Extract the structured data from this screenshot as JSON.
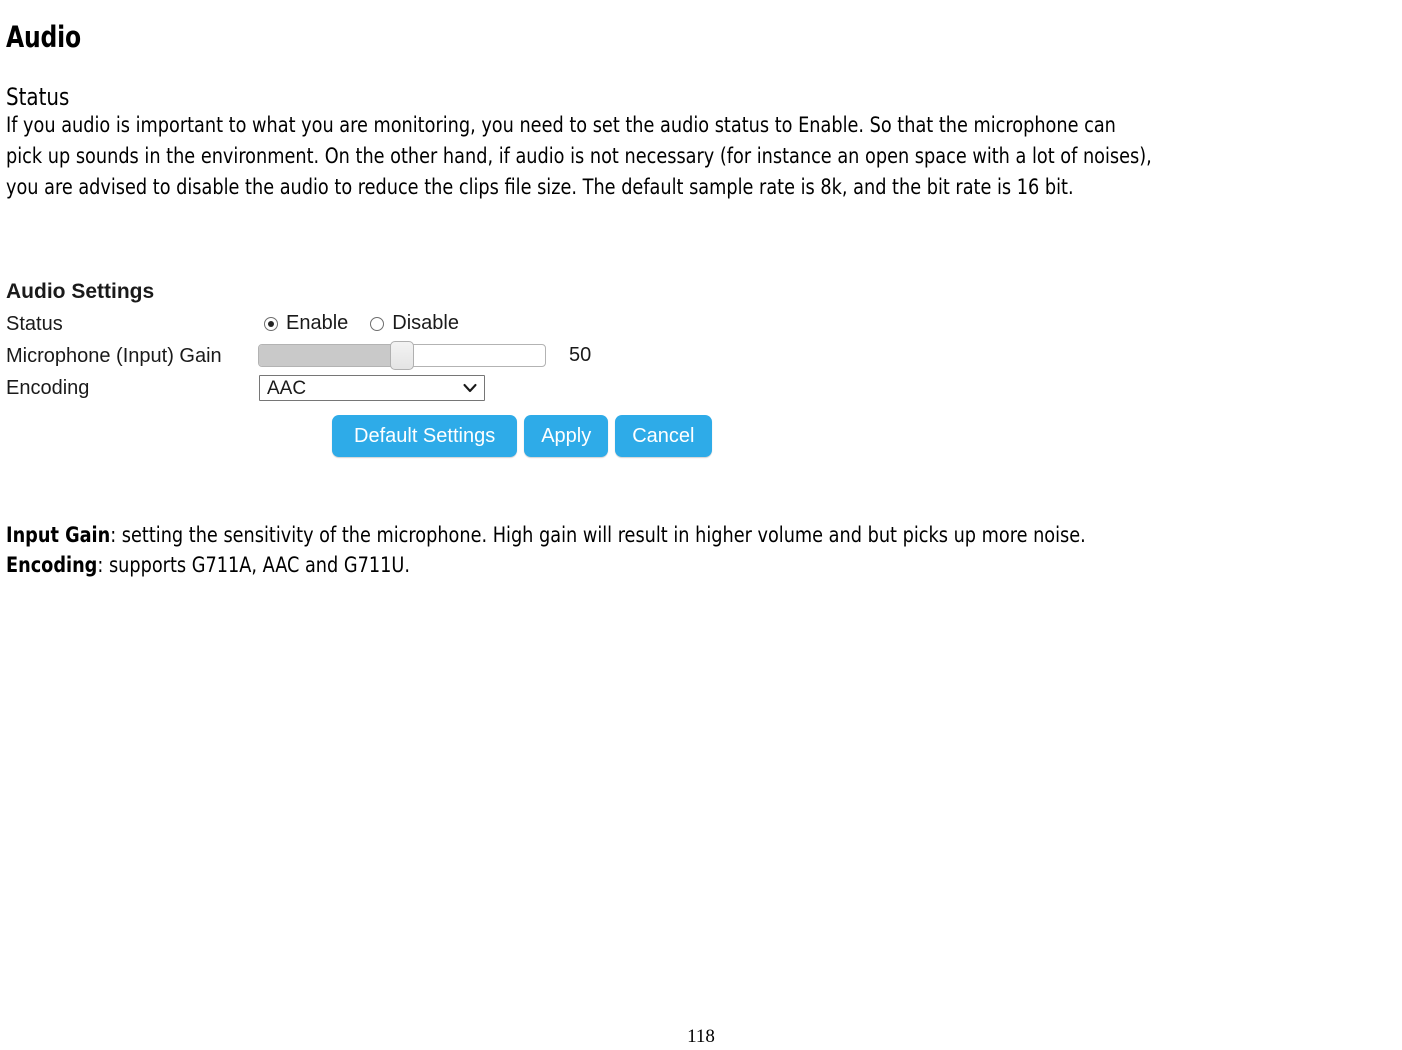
{
  "document": {
    "heading": "Audio",
    "subheading": "Status",
    "paragraph_lines": [
      "If you audio is important to what you are monitoring, you need to set the audio status to Enable. So that the microphone can",
      "pick up sounds in the environment. On the other hand, if audio is not necessary (for instance an open space with a lot of noises),",
      "you are advised to disable the audio to reduce the clips file size. The default sample rate is 8k, and the bit rate is 16 bit."
    ],
    "notes": [
      {
        "term": "Input Gain",
        "text": ": setting the sensitivity of the microphone. High gain will result in higher volume and but picks up more noise."
      },
      {
        "term": "Encoding",
        "text": ": supports G711A, AAC and G711U."
      }
    ],
    "page_number": "118"
  },
  "audio_settings": {
    "panel_title": "Audio Settings",
    "labels": {
      "status": "Status",
      "microphone_gain": "Microphone (Input) Gain",
      "encoding": "Encoding"
    },
    "status": {
      "selected": "Enable",
      "options": [
        {
          "label": "Enable",
          "checked": true
        },
        {
          "label": "Disable",
          "checked": false
        }
      ]
    },
    "gain": {
      "value": "50",
      "percent": 50
    },
    "encoding": {
      "selected": "AAC",
      "options": [
        "G711A",
        "AAC",
        "G711U"
      ]
    },
    "buttons": {
      "default_settings": "Default Settings",
      "apply": "Apply",
      "cancel": "Cancel"
    },
    "colors": {
      "button_blue": "#2eabe8",
      "slider_fill": "#c9c9c9"
    }
  }
}
